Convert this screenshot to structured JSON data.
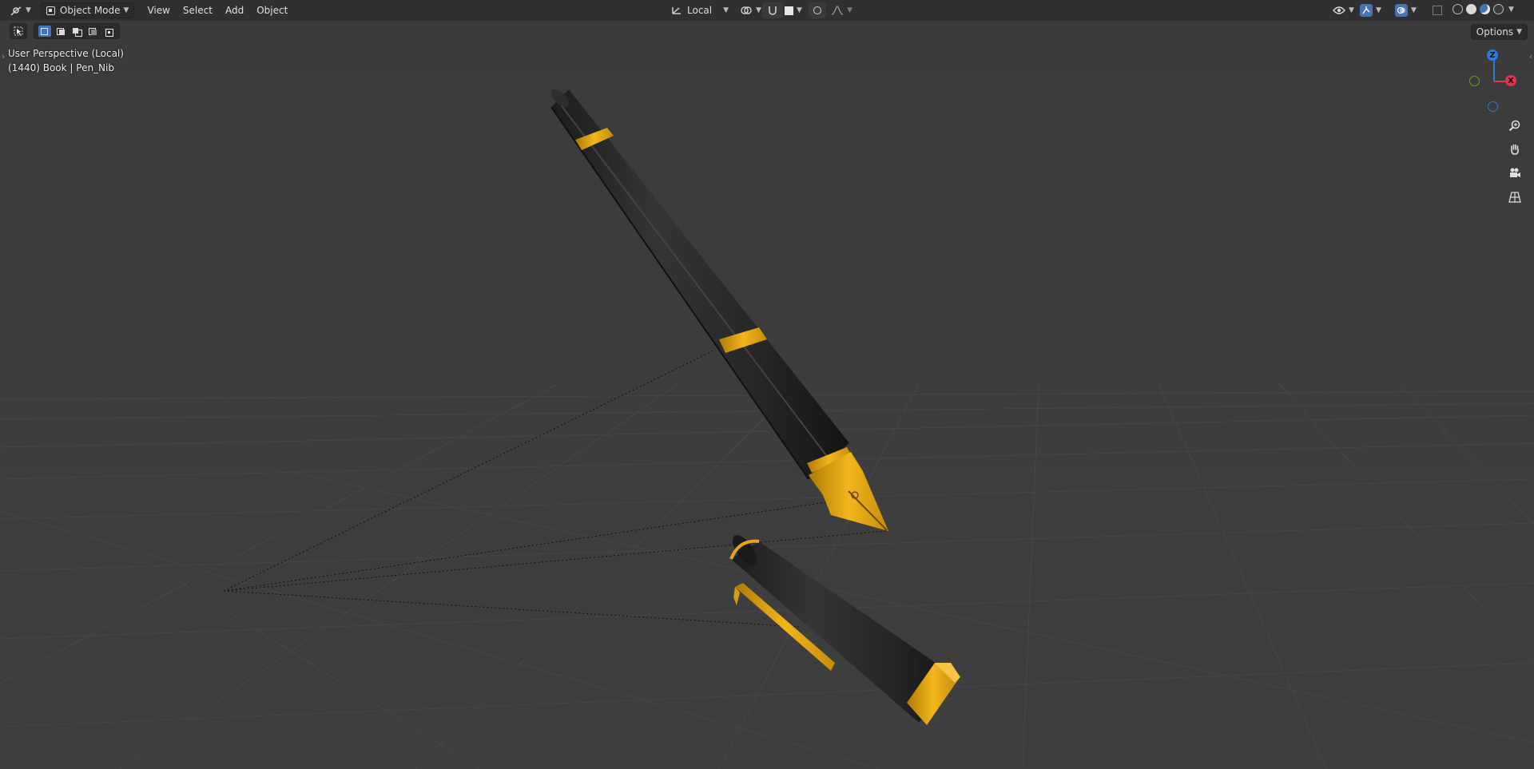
{
  "header": {
    "editor_type_icon": "3d-viewport-icon",
    "mode": "Object Mode",
    "menus": [
      "View",
      "Select",
      "Add",
      "Object"
    ],
    "transform_orientation": "Local",
    "pivot_icon": "pivot-icon",
    "snap_icon": "snap-icon",
    "proportional_icon": "proportional-edit-icon",
    "visibility_icon": "visibility-icon",
    "gizmo_icon": "gizmo-icon",
    "overlay_icon": "overlay-icon",
    "xray_icon": "xray-icon",
    "shading_modes": [
      "wireframe",
      "solid",
      "material-preview",
      "rendered"
    ],
    "active_shading": "material-preview"
  },
  "toolbar": {
    "select_tool_icon": "cursor-select-icon",
    "selection_modes": [
      "set",
      "extend",
      "subtract",
      "invert",
      "intersect"
    ],
    "active_selection_mode": "set"
  },
  "viewport": {
    "view_name": "User Perspective (Local)",
    "object_info": "(1440) Book | Pen_Nib",
    "options_label": "Options",
    "accent_color": "#4772b3",
    "gold_color": "#e6a416",
    "pen_body_color": "#2a2a2a"
  },
  "gizmo": {
    "z_label": "Z",
    "x_label": "X",
    "z_color": "#2e7bd6",
    "x_color": "#e0344e",
    "y_color": "#6ea02a"
  },
  "nav_buttons": [
    "zoom-icon",
    "pan-hand-icon",
    "camera-icon",
    "ortho-grid-icon"
  ]
}
